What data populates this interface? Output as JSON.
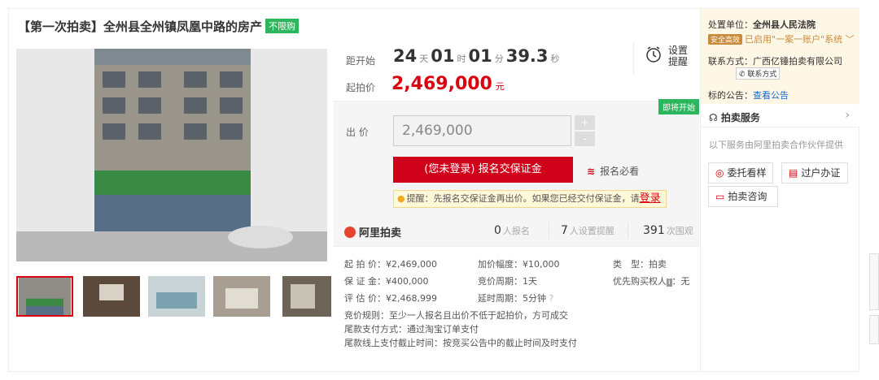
{
  "title": {
    "text": "【第一次拍卖】全州县全州镇凤凰中路的房产",
    "tag": "不限购"
  },
  "auction": {
    "countdown_label": "距开始",
    "days": "24",
    "days_unit": "天",
    "hours": "01",
    "hours_unit": "时",
    "minutes": "01",
    "minutes_unit": "分",
    "seconds": "39.3",
    "seconds_unit": "秒",
    "start_price_label": "起拍价",
    "start_price": "2,469,000",
    "currency_unit": "元",
    "reminder_label": "设置提醒",
    "soon_tag": "即将开始",
    "bid_label": "出 价",
    "bid_value": "2,469,000",
    "plus": "+",
    "minus": "-",
    "signup_button": "(您未登录) 报名交保证金",
    "must_read": "报名必看",
    "tip_text": "提醒：先报名交保证金再出价。如果您已经交付保证金，请",
    "tip_link": "登录"
  },
  "stats": {
    "brand": "阿里拍卖",
    "signups": "0",
    "signups_label": "人报名",
    "reminders": "7",
    "reminders_label": "人设置提醒",
    "views": "391",
    "views_label": "次围观"
  },
  "details": {
    "start_price": "起 拍 价：¥2,469,000",
    "deposit": "保 证 金：¥400,000",
    "appraisal": "评 估 价：¥2,468,999",
    "increment": "加价幅度：¥10,000",
    "cycle": "竞价周期：1天",
    "delay": "延时周期：5分钟",
    "type": "类　型：拍卖",
    "priority": "优先购买权人",
    "priority_value": "：无",
    "rule": "竞价规则：至少一人报名且出价不低于起拍价，方可成交",
    "payment": "尾款支付方式：通过淘宝订单支付",
    "deadline": "尾款线上支付截止时间：按竞买公告中的截止时间及时支付"
  },
  "sidebar": {
    "org_label": "处置单位：",
    "org": "全州县人民法院",
    "safe_badge": "安全高效",
    "safe_text": "已启用\"一案一账户\"系统",
    "contact_label": "联系方式：",
    "contact": "广西亿锤拍卖有限公司",
    "contact_button": "联系方式",
    "notice_label": "标的公告：",
    "notice_link": "查看公告",
    "service_title": "拍卖服务",
    "service_note": "以下服务由阿里拍卖合作伙伴提供",
    "svc_viewing": "委托看样",
    "svc_transfer": "过户办证",
    "svc_consult": "拍卖咨询"
  },
  "colors": {
    "accent_red": "#d9000f",
    "green_tag": "#2cb65d",
    "sidebar_bg": "#fff7e6"
  }
}
